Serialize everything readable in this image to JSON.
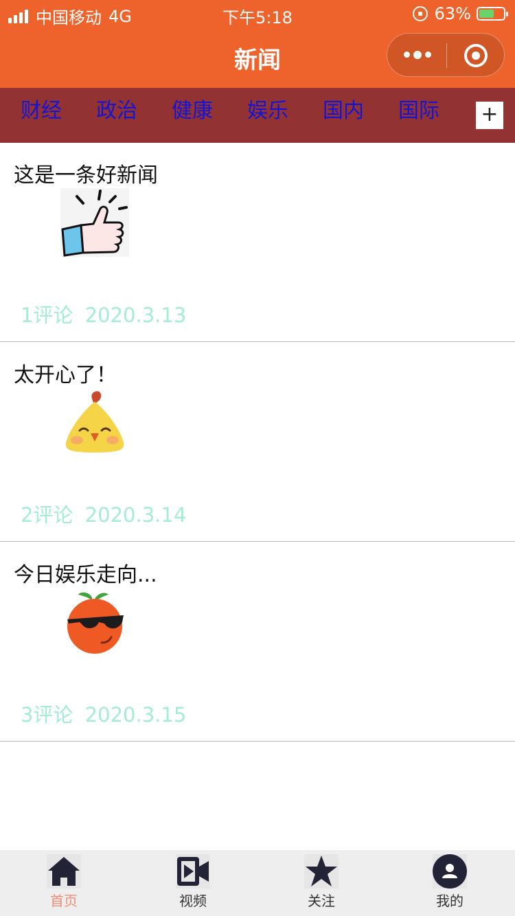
{
  "status_bar": {
    "carrier": "中国移动",
    "network": "4G",
    "time": "下午5:18",
    "battery": "63%",
    "battery_level": 0.63
  },
  "navbar": {
    "title": "新闻",
    "capsule_icons": [
      "more-dots-icon",
      "close-target-icon"
    ]
  },
  "categories": [
    "财经",
    "政治",
    "健康",
    "娱乐",
    "国内",
    "国际"
  ],
  "add_category_label": "+",
  "news": [
    {
      "headline": "这是一条好新闻",
      "comments": "1评论",
      "date": "2020.3.13",
      "image_icon": "thumbs-up-icon"
    },
    {
      "headline": "太开心了！",
      "comments": "2评论",
      "date": "2020.3.14",
      "image_icon": "happy-chick-icon"
    },
    {
      "headline": "今日娱乐走向...",
      "comments": "3评论",
      "date": "2020.3.15",
      "image_icon": "cool-orange-icon"
    }
  ],
  "tabbar": {
    "items": [
      {
        "label": "首页",
        "icon": "home-icon",
        "active": true
      },
      {
        "label": "视频",
        "icon": "video-icon",
        "active": false
      },
      {
        "label": "关注",
        "icon": "star-icon",
        "active": false
      },
      {
        "label": "我的",
        "icon": "user-icon",
        "active": false
      }
    ]
  },
  "colors": {
    "header": "#ed632b",
    "tabs_bg": "#923232",
    "tab_text": "#1414d6",
    "meta_text": "#a4ecd4",
    "active_tab": "#f08c74"
  }
}
